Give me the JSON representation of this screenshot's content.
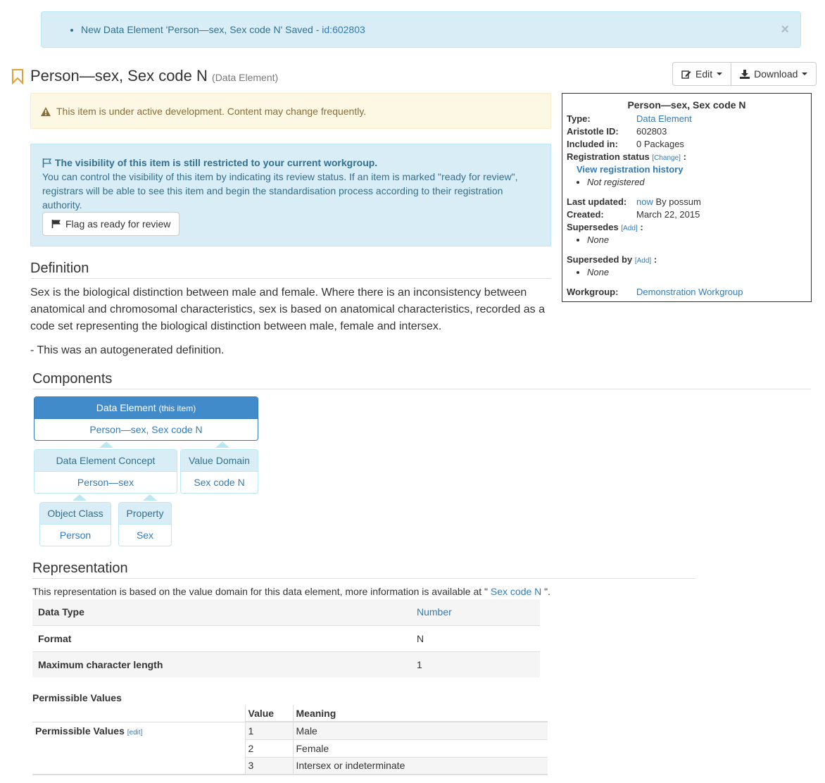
{
  "flash": {
    "message": "New Data Element 'Person—sex, Sex code N' Saved - ",
    "id_link": "id:602803",
    "close": "×"
  },
  "header": {
    "title": "Person—sex, Sex code N",
    "type_label": "(Data Element)",
    "edit_label": "Edit",
    "download_label": "Download"
  },
  "warning": {
    "text": "This item is under active development. Content may change frequently."
  },
  "visibility": {
    "title": "The visibility of this item is still restricted to your current workgroup.",
    "body": "You can control the visibility of this item by indicating its review status. If an item is marked \"ready for review\", registrars will be able to see this item and begin the standardisation process according to their registration authority.",
    "button": "Flag as ready for review"
  },
  "infobox": {
    "title": "Person—sex, Sex code N",
    "type_label": "Type:",
    "type_value": "Data Element",
    "id_label": "Aristotle ID:",
    "id_value": "602803",
    "included_label": "Included in:",
    "included_value": "0 Packages",
    "regstatus_label": "Registration status",
    "regstatus_change": "[Change]",
    "colon": ":",
    "reg_history_link": "View registration history",
    "reg_status_value": "Not registered",
    "updated_label": "Last updated:",
    "updated_link": "now",
    "updated_by": " By possum",
    "created_label": "Created:",
    "created_value": "March 22, 2015",
    "supersedes_label": "Supersedes",
    "supersedes_add": "[Add]",
    "supersedes_value": "None",
    "supersededby_label": "Superseded by",
    "supersededby_add": "[Add]",
    "supersededby_value": "None",
    "workgroup_label": "Workgroup:",
    "workgroup_value": "Demonstration Workgroup"
  },
  "definition": {
    "heading": "Definition",
    "text": "Sex is the biological distinction between male and female. Where there is an inconsistency between anatomical and chromosomal characteristics, sex is based on anatomical characteristics, recorded as a code set representing the biological distinction between male, female and intersex.",
    "note": "- This was an autogenerated definition."
  },
  "components": {
    "heading": "Components",
    "data_element": {
      "header": "Data Element",
      "header_note": "(this item)",
      "value": "Person—sex, Sex code N"
    },
    "dec": {
      "header": "Data Element Concept",
      "value": "Person—sex"
    },
    "value_domain": {
      "header": "Value Domain",
      "value": "Sex code N"
    },
    "object_class": {
      "header": "Object Class",
      "value": "Person"
    },
    "property": {
      "header": "Property",
      "value": "Sex"
    }
  },
  "representation": {
    "heading": "Representation",
    "intro_prefix": "This representation is based on the value domain for this data element, more information is available at \" ",
    "intro_link": "Sex code N",
    "intro_suffix": " \".",
    "rows": [
      {
        "key": "Data Type",
        "value": "Number",
        "is_link": true
      },
      {
        "key": "Format",
        "value": "N",
        "is_link": false
      },
      {
        "key": "Maximum character length",
        "value": "1",
        "is_link": false
      }
    ]
  },
  "permissible_values": {
    "title": "Permissible Values",
    "row_label": "Permissible Values",
    "edit_link": "[edit]",
    "col_value": "Value",
    "col_meaning": "Meaning",
    "rows": [
      {
        "value": "1",
        "meaning": "Male"
      },
      {
        "value": "2",
        "meaning": "Female"
      },
      {
        "value": "3",
        "meaning": "Intersex or indeterminate"
      }
    ]
  }
}
